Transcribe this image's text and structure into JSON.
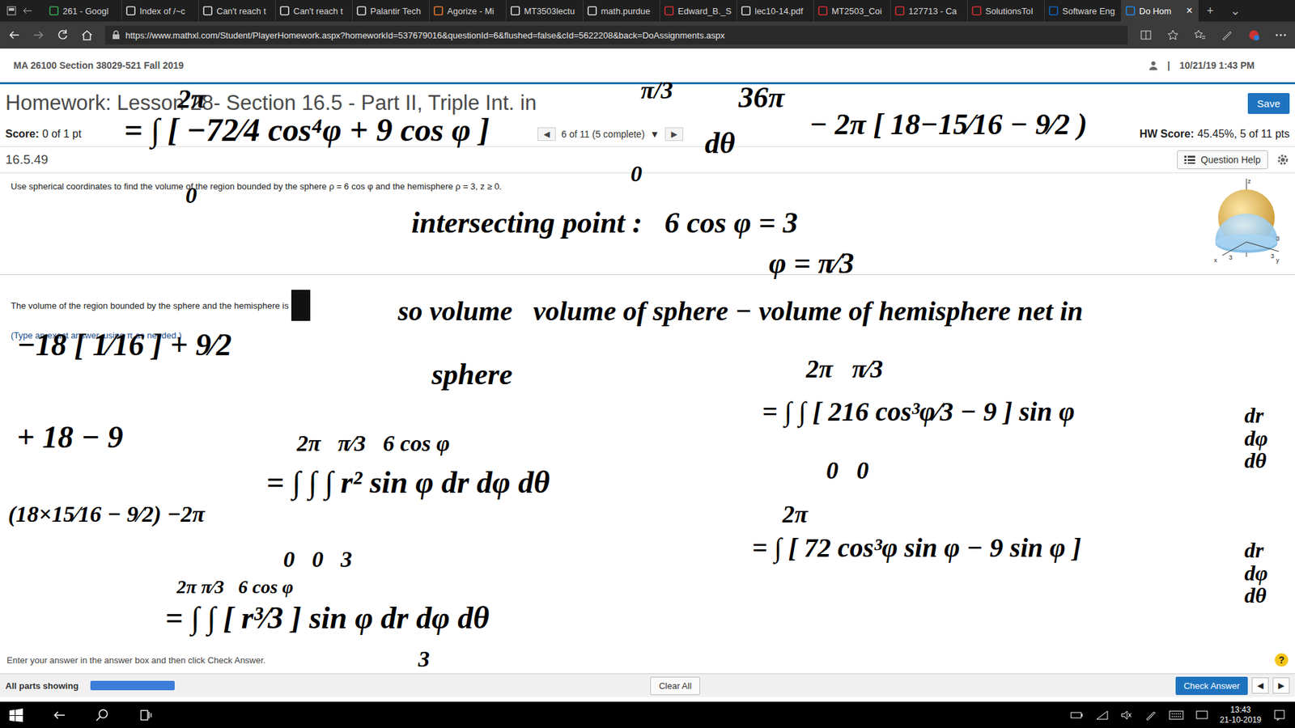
{
  "browser": {
    "tabs": [
      {
        "label": "261 - Googl",
        "selected": false
      },
      {
        "label": "Index of /~c",
        "selected": false
      },
      {
        "label": "Can't reach t",
        "selected": false
      },
      {
        "label": "Can't reach t",
        "selected": false
      },
      {
        "label": "Palantir Tech",
        "selected": false
      },
      {
        "label": "Agorize - Mi",
        "selected": false
      },
      {
        "label": "MT3503lectu",
        "selected": false
      },
      {
        "label": "math.purdue",
        "selected": false
      },
      {
        "label": "Edward_B._S",
        "selected": false
      },
      {
        "label": "lec10-14.pdf",
        "selected": false
      },
      {
        "label": "MT2503_Coi",
        "selected": false
      },
      {
        "label": "127713 - Ca",
        "selected": false
      },
      {
        "label": "SolutionsToI",
        "selected": false
      },
      {
        "label": "Software Eng",
        "selected": false
      },
      {
        "label": "Do Hom",
        "selected": true
      }
    ],
    "close": "×",
    "new_tab": "+",
    "tab_menu": "⌄",
    "url": "https://www.mathxl.com/Student/PlayerHomework.aspx?homeworkId=537679016&questionId=6&flushed=false&cId=5622208&back=DoAssignments.aspx"
  },
  "header": {
    "course": "MA 26100 Section 38029-521 Fall 2019",
    "separator": "|",
    "datetime": "10/21/19 1:43 PM"
  },
  "homework": {
    "title": "Homework: Lesson 28- Section 16.5 - Part II, Triple Int. in",
    "save": "Save",
    "score_label": "Score:",
    "score_value": "0 of 1 pt",
    "hw_score_label": "HW Score:",
    "hw_score_value": "45.45%, 5 of 11 pts"
  },
  "nav": {
    "prev": "◀",
    "position": "6 of 11 (5 complete)",
    "dropdown": "▼",
    "next": "▶"
  },
  "question": {
    "number": "16.5.49",
    "help": "Question Help",
    "text": "Use spherical coordinates to find the volume of the region bounded by the sphere ρ = 6 cos φ and the hemisphere ρ = 3, z ≥ 0.",
    "answer_prompt": "The volume of the region bounded by the sphere and the hemisphere is",
    "hint": "(Type an exact answer, using π as needed.)"
  },
  "figure": {
    "labels": {
      "z": "z",
      "x": "x",
      "y": "y",
      "r1": "3",
      "r2": "3",
      "r3": "3"
    }
  },
  "footer": {
    "instruction": "Enter your answer in the answer box and then click Check Answer.",
    "help": "?",
    "parts": "All parts showing",
    "progress": {
      "level": 1
    },
    "clear": "Clear All",
    "check": "Check Answer",
    "prev": "◀",
    "next": "▶"
  },
  "taskbar": {
    "time": "13:43",
    "date": "21-10-2019"
  },
  "ink": [
    "2π",
    "= ∫ [ −72⁄4 cos⁴φ + 9 cos φ ]",
    "π/3",
    "0",
    "0",
    "dθ",
    "36π",
    "− 2π [ 18−15⁄16 − 9⁄2 )",
    "intersecting point :   6 cos φ = 3",
    "φ = π⁄3",
    "so volume   volume of sphere − volume of hemisphere net in",
    "sphere",
    "2π   π⁄3",
    "= ∫ ∫ [ 216 cos³φ⁄3 − 9 ] sin φ",
    "0   0",
    "dr\ndφ\ndθ",
    "2π",
    "= ∫ [ 72 cos³φ sin φ − 9 sin φ ]",
    "dr\ndφ\ndθ",
    "−18 [ 1⁄16 ] + 9⁄2",
    "+ 18 − 9",
    "(18×15⁄16 − 9⁄2) −2π",
    "2π   π⁄3   6 cos φ",
    "= ∫ ∫ ∫ r² sin φ dr dφ dθ",
    "0   0   3",
    "2π π⁄3   6 cos φ",
    "= ∫ ∫ [ r³⁄3 ] sin φ dr dφ dθ",
    "3"
  ]
}
